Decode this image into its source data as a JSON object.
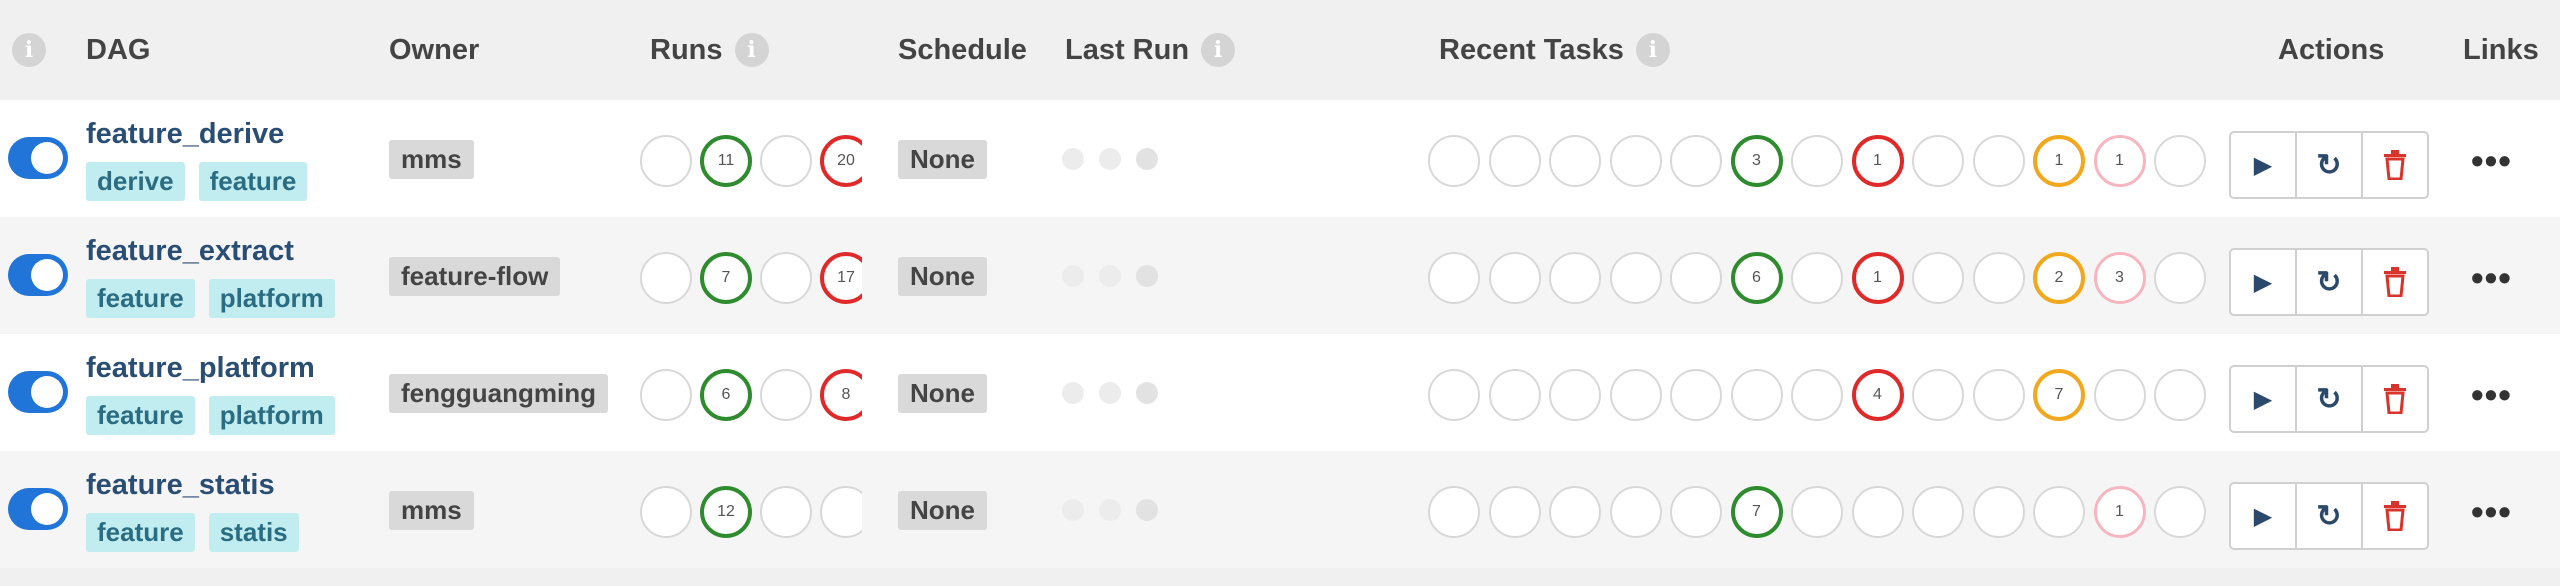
{
  "header": {
    "dag": "DAG",
    "owner": "Owner",
    "runs": "Runs",
    "schedule": "Schedule",
    "last_run": "Last Run",
    "recent_tasks": "Recent Tasks",
    "actions": "Actions",
    "links": "Links",
    "info_glyph": "i"
  },
  "colors": {
    "success": "#2e8b2e",
    "failed": "#e02a2a",
    "upstream_failed": "#f2a81e",
    "up_for_retry": "#f5b6c0",
    "toggle": "#2174d8",
    "tag_bg": "#c2edf0"
  },
  "actions": {
    "trigger_icon": "play-icon",
    "refresh_icon": "refresh-icon",
    "delete_icon": "trash-icon",
    "trigger_glyph": "▶",
    "refresh_glyph": "↻",
    "delete_glyph": "🗑",
    "links_glyph": "•••"
  },
  "dags": [
    {
      "name": "feature_derive",
      "tags": [
        "derive",
        "feature"
      ],
      "owner": "mms",
      "schedule": "None",
      "enabled": true,
      "runs": [
        {
          "state": "none",
          "count": ""
        },
        {
          "state": "success",
          "count": "11"
        },
        {
          "state": "none",
          "count": ""
        },
        {
          "state": "failed",
          "count": "20"
        }
      ],
      "tasks": [
        {
          "state": "none",
          "count": ""
        },
        {
          "state": "none",
          "count": ""
        },
        {
          "state": "none",
          "count": ""
        },
        {
          "state": "none",
          "count": ""
        },
        {
          "state": "none",
          "count": ""
        },
        {
          "state": "success",
          "count": "3"
        },
        {
          "state": "none",
          "count": ""
        },
        {
          "state": "failed",
          "count": "1"
        },
        {
          "state": "none",
          "count": ""
        },
        {
          "state": "none",
          "count": ""
        },
        {
          "state": "upstream_failed",
          "count": "1"
        },
        {
          "state": "up_for_retry",
          "count": "1"
        },
        {
          "state": "none",
          "count": ""
        }
      ]
    },
    {
      "name": "feature_extract",
      "tags": [
        "feature",
        "platform"
      ],
      "owner": "feature-flow",
      "schedule": "None",
      "enabled": true,
      "runs": [
        {
          "state": "none",
          "count": ""
        },
        {
          "state": "success",
          "count": "7"
        },
        {
          "state": "none",
          "count": ""
        },
        {
          "state": "failed",
          "count": "17"
        }
      ],
      "tasks": [
        {
          "state": "none",
          "count": ""
        },
        {
          "state": "none",
          "count": ""
        },
        {
          "state": "none",
          "count": ""
        },
        {
          "state": "none",
          "count": ""
        },
        {
          "state": "none",
          "count": ""
        },
        {
          "state": "success",
          "count": "6"
        },
        {
          "state": "none",
          "count": ""
        },
        {
          "state": "failed",
          "count": "1"
        },
        {
          "state": "none",
          "count": ""
        },
        {
          "state": "none",
          "count": ""
        },
        {
          "state": "upstream_failed",
          "count": "2"
        },
        {
          "state": "up_for_retry",
          "count": "3"
        },
        {
          "state": "none",
          "count": ""
        }
      ]
    },
    {
      "name": "feature_platform",
      "tags": [
        "feature",
        "platform"
      ],
      "owner": "fengguangming",
      "schedule": "None",
      "enabled": true,
      "runs": [
        {
          "state": "none",
          "count": ""
        },
        {
          "state": "success",
          "count": "6"
        },
        {
          "state": "none",
          "count": ""
        },
        {
          "state": "failed",
          "count": "8"
        }
      ],
      "tasks": [
        {
          "state": "none",
          "count": ""
        },
        {
          "state": "none",
          "count": ""
        },
        {
          "state": "none",
          "count": ""
        },
        {
          "state": "none",
          "count": ""
        },
        {
          "state": "none",
          "count": ""
        },
        {
          "state": "none",
          "count": ""
        },
        {
          "state": "none",
          "count": ""
        },
        {
          "state": "failed",
          "count": "4"
        },
        {
          "state": "none",
          "count": ""
        },
        {
          "state": "none",
          "count": ""
        },
        {
          "state": "upstream_failed",
          "count": "7"
        },
        {
          "state": "none",
          "count": ""
        },
        {
          "state": "none",
          "count": ""
        }
      ]
    },
    {
      "name": "feature_statis",
      "tags": [
        "feature",
        "statis"
      ],
      "owner": "mms",
      "schedule": "None",
      "enabled": true,
      "runs": [
        {
          "state": "none",
          "count": ""
        },
        {
          "state": "success",
          "count": "12"
        },
        {
          "state": "none",
          "count": ""
        },
        {
          "state": "none",
          "count": ""
        }
      ],
      "tasks": [
        {
          "state": "none",
          "count": ""
        },
        {
          "state": "none",
          "count": ""
        },
        {
          "state": "none",
          "count": ""
        },
        {
          "state": "none",
          "count": ""
        },
        {
          "state": "none",
          "count": ""
        },
        {
          "state": "success",
          "count": "7"
        },
        {
          "state": "none",
          "count": ""
        },
        {
          "state": "none",
          "count": ""
        },
        {
          "state": "none",
          "count": ""
        },
        {
          "state": "none",
          "count": ""
        },
        {
          "state": "none",
          "count": ""
        },
        {
          "state": "up_for_retry",
          "count": "1"
        },
        {
          "state": "none",
          "count": ""
        }
      ]
    }
  ]
}
